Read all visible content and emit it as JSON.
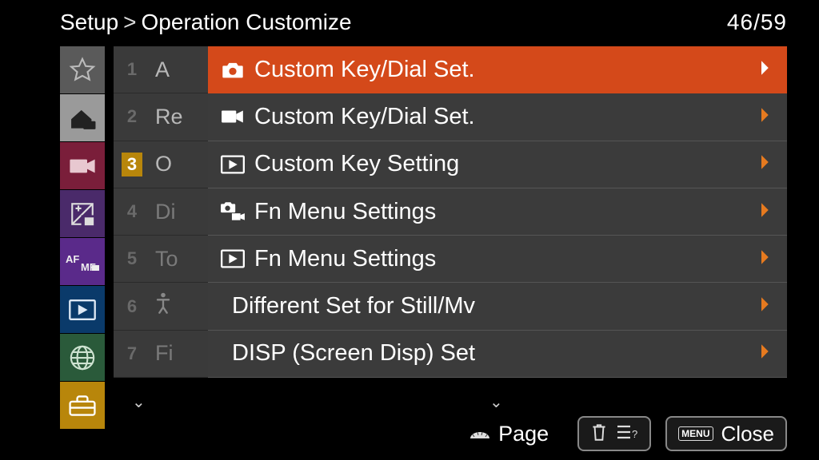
{
  "header": {
    "breadcrumb_root": "Setup",
    "breadcrumb_sep": ">",
    "breadcrumb_leaf": "Operation Customize",
    "page_counter": "46/59"
  },
  "category_rail": [
    {
      "name": "favorites",
      "bg": "#5a5a5a"
    },
    {
      "name": "main",
      "bg": "#9a9a9a"
    },
    {
      "name": "shooting",
      "bg": "#7a1e3a"
    },
    {
      "name": "exposure",
      "bg": "#4a2a6a"
    },
    {
      "name": "focus",
      "bg": "#5a2a8a"
    },
    {
      "name": "playback",
      "bg": "#0a3a6a"
    },
    {
      "name": "network",
      "bg": "#2a5a3a"
    },
    {
      "name": "setup",
      "bg": "#b8860b"
    }
  ],
  "submenu": {
    "items": [
      {
        "num": "1",
        "label": "A",
        "hot": false
      },
      {
        "num": "2",
        "label": "Re",
        "hot": false
      },
      {
        "num": "3",
        "label": "O",
        "hot": true
      },
      {
        "num": "4",
        "label": "Di",
        "hot": false
      },
      {
        "num": "5",
        "label": "To",
        "hot": false
      },
      {
        "num": "6",
        "label": "",
        "hot": false
      },
      {
        "num": "7",
        "label": "Fi",
        "hot": false
      }
    ]
  },
  "options": [
    {
      "icon": "camera",
      "label": "Custom Key/Dial Set.",
      "selected": true,
      "chevron": true
    },
    {
      "icon": "movie",
      "label": "Custom Key/Dial Set.",
      "selected": false,
      "chevron": true
    },
    {
      "icon": "playback",
      "label": "Custom Key Setting",
      "selected": false,
      "chevron": true
    },
    {
      "icon": "cammovie",
      "label": "Fn Menu Settings",
      "selected": false,
      "chevron": true
    },
    {
      "icon": "playback",
      "label": "Fn Menu Settings",
      "selected": false,
      "chevron": true
    },
    {
      "icon": "",
      "label": "Different Set for Still/Mv",
      "selected": false,
      "chevron": true
    },
    {
      "icon": "",
      "label": "DISP (Screen Disp) Set",
      "selected": false,
      "chevron": true
    }
  ],
  "footer": {
    "page_label": "Page",
    "close_label": "Close",
    "menu_badge": "MENU"
  }
}
